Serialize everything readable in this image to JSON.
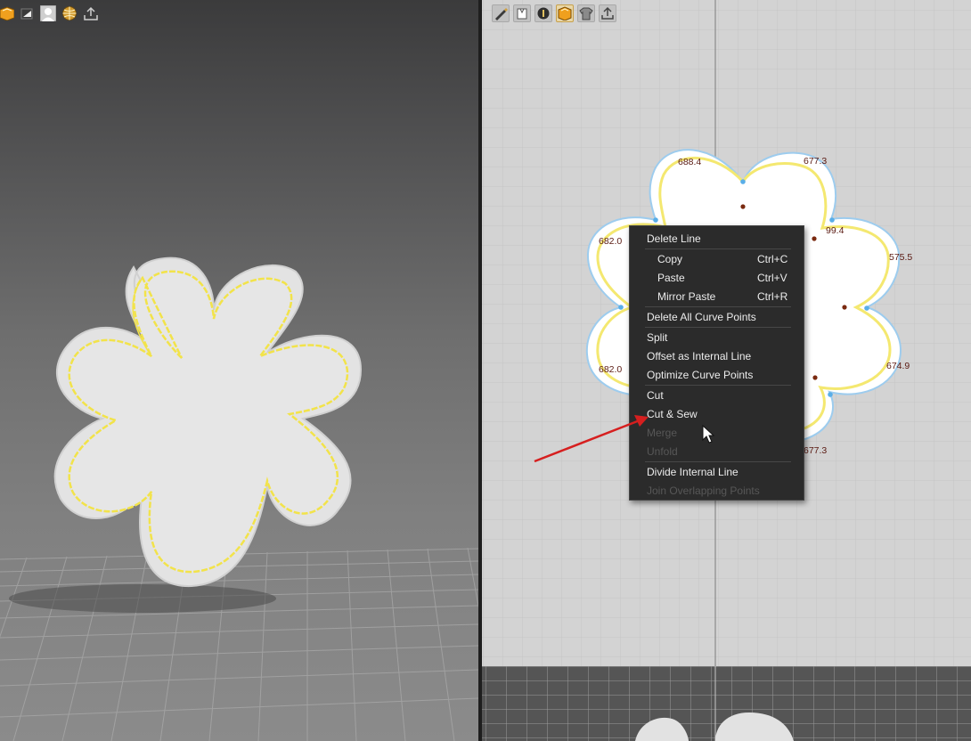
{
  "left_toolbar": {
    "icons": [
      "orange-box-icon",
      "white-box-icon",
      "avatar-icon",
      "globe-icon",
      "export-icon"
    ]
  },
  "right_toolbar": {
    "icons": [
      "pen-tool-icon",
      "garment-icon",
      "circle-tool-icon",
      "orange-box-icon",
      "shirt-icon",
      "export-icon"
    ]
  },
  "measurements": {
    "top_left": "688.4",
    "top_right": "677.3",
    "upper_right": "99.4",
    "right": "575.5",
    "left_upper": "682.0",
    "left_lower": "682.0",
    "lower_right": "674.9",
    "bottom_right": "677.3"
  },
  "context_menu": {
    "items": [
      {
        "label": "Delete Line"
      },
      {
        "label": "Copy",
        "shortcut": "Ctrl+C"
      },
      {
        "label": "Paste",
        "shortcut": "Ctrl+V"
      },
      {
        "label": "Mirror Paste",
        "shortcut": "Ctrl+R"
      },
      {
        "label": "Delete All Curve Points"
      },
      {
        "label": "Split"
      },
      {
        "label": "Offset as Internal Line"
      },
      {
        "label": "Optimize Curve Points"
      },
      {
        "label": "Cut"
      },
      {
        "label": "Cut & Sew"
      },
      {
        "label": "Merge",
        "disabled": true
      },
      {
        "label": "Unfold",
        "disabled": true
      },
      {
        "label": "Divide Internal Line"
      },
      {
        "label": "Join Overlapping Points",
        "disabled": true
      }
    ]
  },
  "colors": {
    "pointer_arrow": "#d61f1f",
    "stitch_line": "#f2e34a",
    "pattern_fill": "#ffffff",
    "pattern_outline": "#8fc3ea"
  }
}
